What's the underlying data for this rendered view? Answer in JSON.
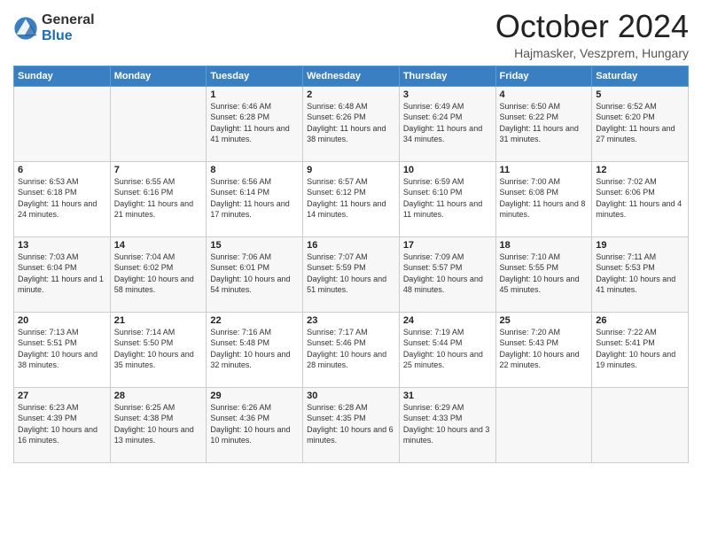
{
  "header": {
    "logo_general": "General",
    "logo_blue": "Blue",
    "title": "October 2024",
    "subtitle": "Hajmasker, Veszprem, Hungary"
  },
  "days_of_week": [
    "Sunday",
    "Monday",
    "Tuesday",
    "Wednesday",
    "Thursday",
    "Friday",
    "Saturday"
  ],
  "weeks": [
    [
      {
        "day": "",
        "info": ""
      },
      {
        "day": "",
        "info": ""
      },
      {
        "day": "1",
        "info": "Sunrise: 6:46 AM\nSunset: 6:28 PM\nDaylight: 11 hours and 41 minutes."
      },
      {
        "day": "2",
        "info": "Sunrise: 6:48 AM\nSunset: 6:26 PM\nDaylight: 11 hours and 38 minutes."
      },
      {
        "day": "3",
        "info": "Sunrise: 6:49 AM\nSunset: 6:24 PM\nDaylight: 11 hours and 34 minutes."
      },
      {
        "day": "4",
        "info": "Sunrise: 6:50 AM\nSunset: 6:22 PM\nDaylight: 11 hours and 31 minutes."
      },
      {
        "day": "5",
        "info": "Sunrise: 6:52 AM\nSunset: 6:20 PM\nDaylight: 11 hours and 27 minutes."
      }
    ],
    [
      {
        "day": "6",
        "info": "Sunrise: 6:53 AM\nSunset: 6:18 PM\nDaylight: 11 hours and 24 minutes."
      },
      {
        "day": "7",
        "info": "Sunrise: 6:55 AM\nSunset: 6:16 PM\nDaylight: 11 hours and 21 minutes."
      },
      {
        "day": "8",
        "info": "Sunrise: 6:56 AM\nSunset: 6:14 PM\nDaylight: 11 hours and 17 minutes."
      },
      {
        "day": "9",
        "info": "Sunrise: 6:57 AM\nSunset: 6:12 PM\nDaylight: 11 hours and 14 minutes."
      },
      {
        "day": "10",
        "info": "Sunrise: 6:59 AM\nSunset: 6:10 PM\nDaylight: 11 hours and 11 minutes."
      },
      {
        "day": "11",
        "info": "Sunrise: 7:00 AM\nSunset: 6:08 PM\nDaylight: 11 hours and 8 minutes."
      },
      {
        "day": "12",
        "info": "Sunrise: 7:02 AM\nSunset: 6:06 PM\nDaylight: 11 hours and 4 minutes."
      }
    ],
    [
      {
        "day": "13",
        "info": "Sunrise: 7:03 AM\nSunset: 6:04 PM\nDaylight: 11 hours and 1 minute."
      },
      {
        "day": "14",
        "info": "Sunrise: 7:04 AM\nSunset: 6:02 PM\nDaylight: 10 hours and 58 minutes."
      },
      {
        "day": "15",
        "info": "Sunrise: 7:06 AM\nSunset: 6:01 PM\nDaylight: 10 hours and 54 minutes."
      },
      {
        "day": "16",
        "info": "Sunrise: 7:07 AM\nSunset: 5:59 PM\nDaylight: 10 hours and 51 minutes."
      },
      {
        "day": "17",
        "info": "Sunrise: 7:09 AM\nSunset: 5:57 PM\nDaylight: 10 hours and 48 minutes."
      },
      {
        "day": "18",
        "info": "Sunrise: 7:10 AM\nSunset: 5:55 PM\nDaylight: 10 hours and 45 minutes."
      },
      {
        "day": "19",
        "info": "Sunrise: 7:11 AM\nSunset: 5:53 PM\nDaylight: 10 hours and 41 minutes."
      }
    ],
    [
      {
        "day": "20",
        "info": "Sunrise: 7:13 AM\nSunset: 5:51 PM\nDaylight: 10 hours and 38 minutes."
      },
      {
        "day": "21",
        "info": "Sunrise: 7:14 AM\nSunset: 5:50 PM\nDaylight: 10 hours and 35 minutes."
      },
      {
        "day": "22",
        "info": "Sunrise: 7:16 AM\nSunset: 5:48 PM\nDaylight: 10 hours and 32 minutes."
      },
      {
        "day": "23",
        "info": "Sunrise: 7:17 AM\nSunset: 5:46 PM\nDaylight: 10 hours and 28 minutes."
      },
      {
        "day": "24",
        "info": "Sunrise: 7:19 AM\nSunset: 5:44 PM\nDaylight: 10 hours and 25 minutes."
      },
      {
        "day": "25",
        "info": "Sunrise: 7:20 AM\nSunset: 5:43 PM\nDaylight: 10 hours and 22 minutes."
      },
      {
        "day": "26",
        "info": "Sunrise: 7:22 AM\nSunset: 5:41 PM\nDaylight: 10 hours and 19 minutes."
      }
    ],
    [
      {
        "day": "27",
        "info": "Sunrise: 6:23 AM\nSunset: 4:39 PM\nDaylight: 10 hours and 16 minutes."
      },
      {
        "day": "28",
        "info": "Sunrise: 6:25 AM\nSunset: 4:38 PM\nDaylight: 10 hours and 13 minutes."
      },
      {
        "day": "29",
        "info": "Sunrise: 6:26 AM\nSunset: 4:36 PM\nDaylight: 10 hours and 10 minutes."
      },
      {
        "day": "30",
        "info": "Sunrise: 6:28 AM\nSunset: 4:35 PM\nDaylight: 10 hours and 6 minutes."
      },
      {
        "day": "31",
        "info": "Sunrise: 6:29 AM\nSunset: 4:33 PM\nDaylight: 10 hours and 3 minutes."
      },
      {
        "day": "",
        "info": ""
      },
      {
        "day": "",
        "info": ""
      }
    ]
  ]
}
